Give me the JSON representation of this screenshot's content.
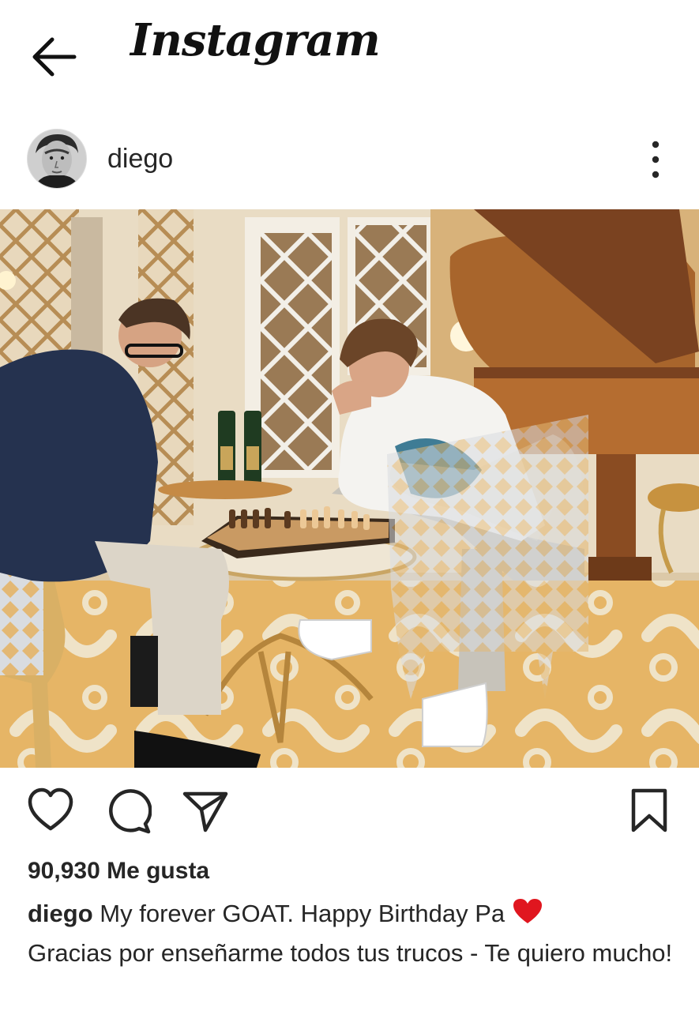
{
  "app": {
    "title": "Instagram"
  },
  "post": {
    "username": "diego",
    "likes": "90,930 Me gusta",
    "caption_username": "diego",
    "caption_line1": "My forever GOAT. Happy Birthday Pa",
    "caption_rest": "Gracias por enseñarme todos tus trucos - Te quiero mucho!",
    "caption_emoji": "red-heart"
  },
  "icons": {
    "back": "arrow-left-icon",
    "more": "more-vertical-icon",
    "like": "heart-icon",
    "comment": "comment-icon",
    "share": "send-icon",
    "save": "bookmark-icon"
  },
  "colors": {
    "text": "#262626",
    "background": "#ffffff",
    "heart": "#e0161f"
  }
}
